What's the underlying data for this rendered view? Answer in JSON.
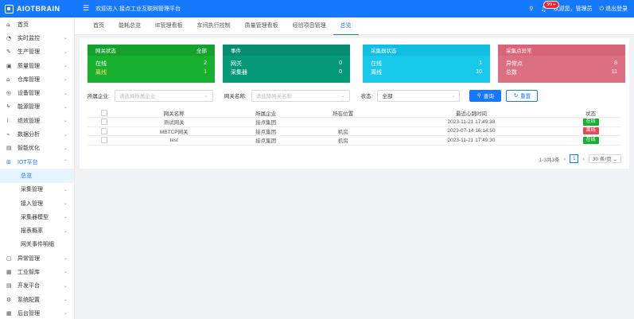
{
  "app": {
    "logo_text": "AIOTBRAIN",
    "welcome": "欢迎进入 接点工业互联网管理平台",
    "notify_count": "99+",
    "user_greeting": "欢迎您，管理员",
    "logout": "退出登录"
  },
  "sidebar": {
    "items": [
      {
        "label": "首页",
        "icon": "home-icon",
        "glyph": "⌂",
        "chevron": false
      },
      {
        "label": "实时监控",
        "icon": "monitor-icon",
        "glyph": "◔",
        "chevron": true
      },
      {
        "label": "生产管理",
        "icon": "tool-icon",
        "glyph": "✎",
        "chevron": true
      },
      {
        "label": "质量管理",
        "icon": "quality-icon",
        "glyph": "▣",
        "chevron": true
      },
      {
        "label": "仓库管理",
        "icon": "warehouse-icon",
        "glyph": "⌂",
        "chevron": true
      },
      {
        "label": "设备管理",
        "icon": "device-icon",
        "glyph": "◎",
        "chevron": true
      },
      {
        "label": "能源管理",
        "icon": "energy-icon",
        "glyph": "ϟ",
        "chevron": true
      },
      {
        "label": "绩效管理",
        "icon": "chart-icon",
        "glyph": "⌇",
        "chevron": true
      },
      {
        "label": "数据分析",
        "icon": "analysis-icon",
        "glyph": "⌁",
        "chevron": true
      },
      {
        "label": "智能优化",
        "icon": "optimize-icon",
        "glyph": "▤",
        "chevron": true
      },
      {
        "label": "IOT平台",
        "icon": "iot-icon",
        "glyph": "⊞",
        "chevron": true,
        "open": true
      },
      {
        "label": "总览",
        "sub": true,
        "active": true
      },
      {
        "label": "采集管理",
        "sub": true,
        "chevron": true
      },
      {
        "label": "接入管理",
        "sub": true,
        "chevron": true
      },
      {
        "label": "采集器模型",
        "sub": true,
        "chevron": true
      },
      {
        "label": "报表概率",
        "sub": true,
        "chevron": true
      },
      {
        "label": "网关事件明细",
        "sub": true
      },
      {
        "label": "异常管理",
        "icon": "alert-icon",
        "glyph": "▢",
        "chevron": true
      },
      {
        "label": "工业智库",
        "icon": "library-icon",
        "glyph": "▦",
        "chevron": true
      },
      {
        "label": "开发平台",
        "icon": "dev-icon",
        "glyph": "▤",
        "chevron": true
      },
      {
        "label": "系统配置",
        "icon": "settings-icon",
        "glyph": "⚙",
        "chevron": true
      },
      {
        "label": "后台管理",
        "icon": "admin-icon",
        "glyph": "▦",
        "chevron": true
      }
    ]
  },
  "tabs": [
    {
      "label": "首页",
      "active": false
    },
    {
      "label": "能耗总览",
      "active": false
    },
    {
      "label": "IE管理看板",
      "active": false
    },
    {
      "label": "车间执行控制",
      "active": false
    },
    {
      "label": "质量管理看板",
      "active": false
    },
    {
      "label": "经验项目管理",
      "active": false
    },
    {
      "label": "总览",
      "active": true
    }
  ],
  "cards": [
    {
      "title": "网关状态",
      "extra": "全部",
      "rows": [
        {
          "label": "在线",
          "value": "2"
        },
        {
          "label": "离线",
          "value": "1"
        }
      ]
    },
    {
      "title": "事件",
      "extra": "",
      "rows": [
        {
          "label": "网关",
          "value": "0"
        },
        {
          "label": "采集器",
          "value": "0"
        }
      ]
    },
    {
      "title": "采集器状态",
      "extra": "",
      "rows": [
        {
          "label": "在线",
          "value": "1"
        },
        {
          "label": "离线",
          "value": "10"
        }
      ]
    },
    {
      "title": "采集点异常",
      "extra": "",
      "rows": [
        {
          "label": "异常点",
          "value": "8"
        },
        {
          "label": "总数",
          "value": "11"
        }
      ]
    }
  ],
  "filters": {
    "company_label": "所属企业:",
    "company_placeholder": "请选择所属企业",
    "gateway_label": "网关名称:",
    "gateway_placeholder": "请选择网关名称",
    "status_label": "状态:",
    "status_value": "全部",
    "search_label": "查询",
    "reset_label": "重置"
  },
  "table": {
    "headers": [
      "网关名称",
      "所属企业",
      "所在位置",
      "最近心跳时间",
      "状态"
    ],
    "rows": [
      [
        "测试网关",
        "接点集团",
        "",
        "2023-11-21 17:49:38",
        "在线"
      ],
      [
        "MBTCP网关",
        "接点集团",
        "机房",
        "2023-07-14 16:14:50",
        "离线"
      ],
      [
        "test",
        "接点集团",
        "机房",
        "2023-11-21 17:49:30",
        "在线"
      ]
    ]
  },
  "pagination": {
    "total_text": "1-3共3条",
    "current_page": "1",
    "page_size": "30 条/页"
  },
  "colors": {
    "primary": "#1677ff",
    "online": "#17b030",
    "offline": "#e84c5c"
  }
}
